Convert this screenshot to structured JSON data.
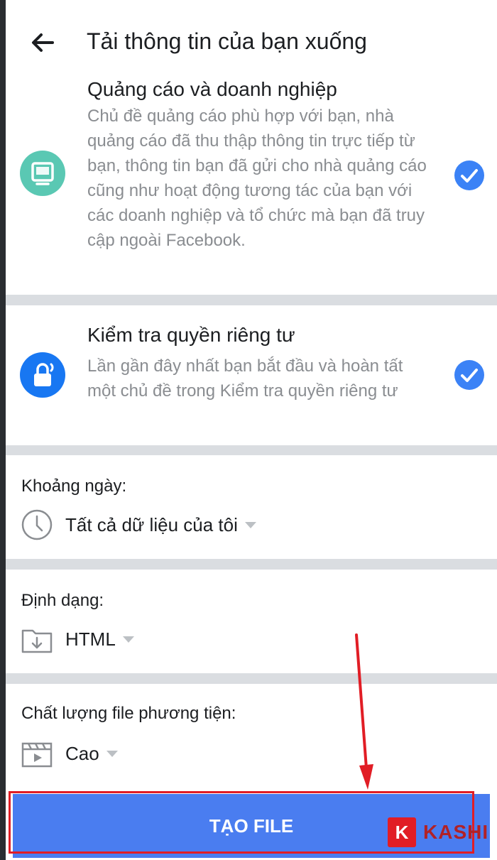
{
  "header": {
    "title": "Tải thông tin của bạn xuống"
  },
  "categories": [
    {
      "title": "Quảng cáo và doanh nghiệp",
      "description": "Chủ đề quảng cáo phù hợp với bạn, nhà quảng cáo đã thu thập thông tin trực tiếp từ bạn, thông tin bạn đã gửi cho nhà quảng cáo cũng như hoạt động tương tác của bạn với các doanh nghiệp và tổ chức mà bạn đã truy cập ngoài Facebook.",
      "icon": "ads-monitor-icon",
      "icon_color": "#5ac8b3",
      "checked": true
    },
    {
      "title": "Kiểm tra quyền riêng tư",
      "description": "Lần gần đây nhất bạn bắt đầu và hoàn tất một chủ đề trong Kiểm tra quyền riêng tư",
      "icon": "privacy-lock-icon",
      "icon_color": "#1877f2",
      "checked": true
    }
  ],
  "date_range": {
    "label": "Khoảng ngày:",
    "value": "Tất cả dữ liệu của tôi",
    "icon": "clock-icon"
  },
  "format": {
    "label": "Định dạng:",
    "value": "HTML",
    "icon": "download-folder-icon"
  },
  "media_quality": {
    "label": "Chất lượng file phương tiện:",
    "value": "Cao",
    "icon": "video-clapper-icon"
  },
  "submit": {
    "label": "TẠO FILE",
    "color": "#4a7df0"
  },
  "annotation": {
    "highlight_color": "#e11d25"
  },
  "watermark": {
    "letter": "K",
    "text": "KASHI"
  }
}
